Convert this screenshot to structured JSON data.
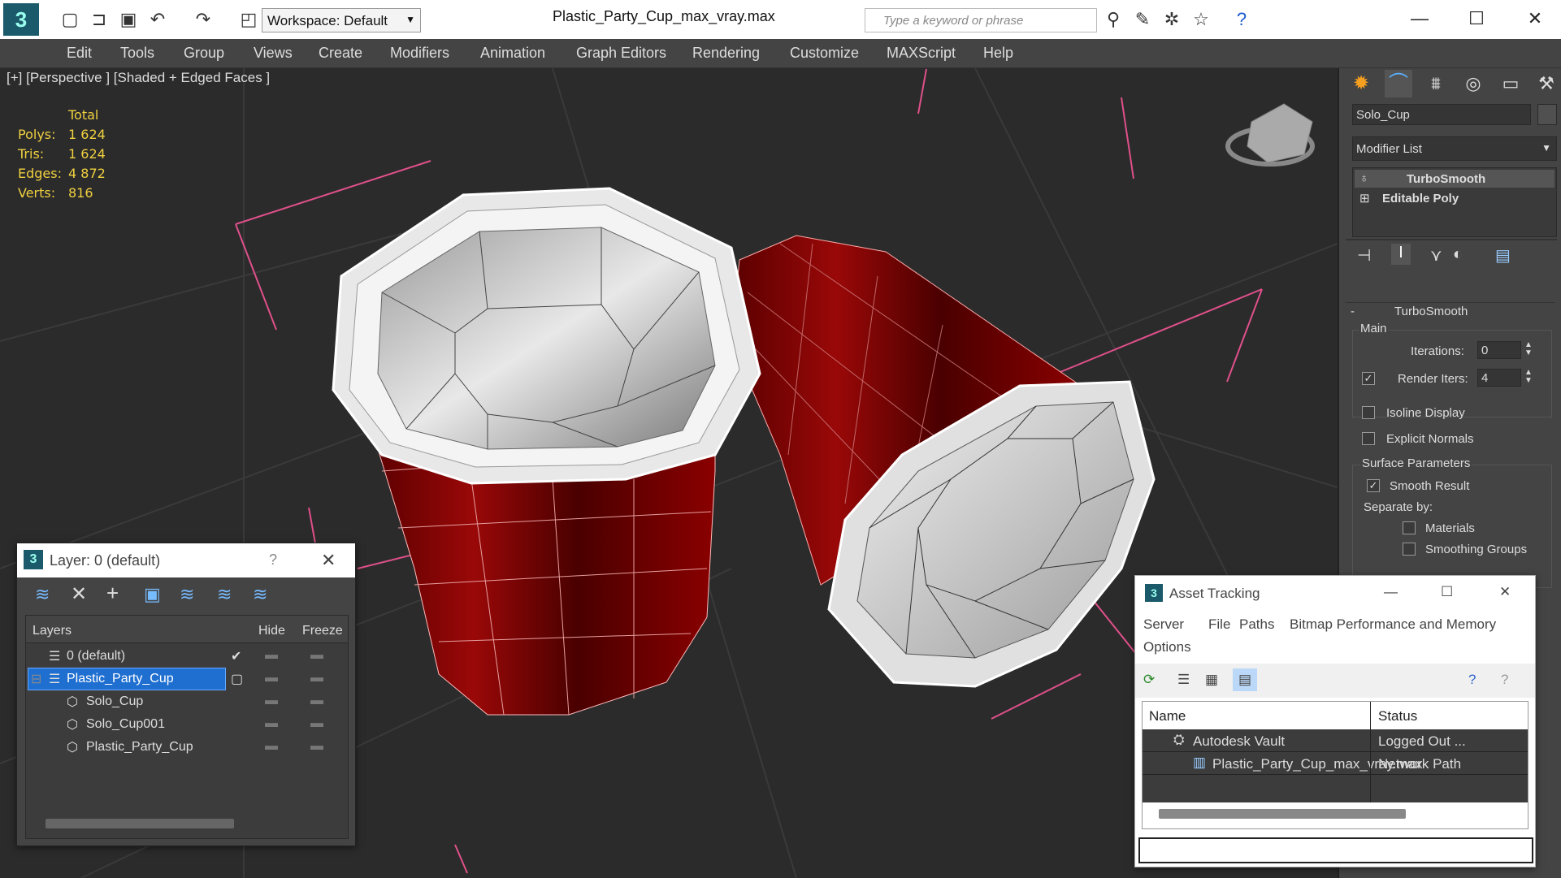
{
  "titlebar": {
    "workspace": "Workspace: Default",
    "file_title": "Plastic_Party_Cup_max_vray.max",
    "search_placeholder": "Type a keyword or phrase"
  },
  "menu": [
    "Edit",
    "Tools",
    "Group",
    "Views",
    "Create",
    "Modifiers",
    "Animation",
    "Graph Editors",
    "Rendering",
    "Customize",
    "MAXScript",
    "Help"
  ],
  "viewport": {
    "label": "[+] [Perspective ] [Shaded + Edged Faces ]",
    "stats_header": "Total",
    "stats": [
      {
        "label": "Polys:",
        "value": "1 624"
      },
      {
        "label": "Tris:",
        "value": "1 624"
      },
      {
        "label": "Edges:",
        "value": "4 872"
      },
      {
        "label": "Verts:",
        "value": "816"
      }
    ]
  },
  "command_panel": {
    "object_name": "Solo_Cup",
    "modifier_list": "Modifier List",
    "stack": [
      "TurboSmooth",
      "Editable Poly"
    ],
    "rollout_title": "TurboSmooth",
    "main_label": "Main",
    "iterations_label": "Iterations:",
    "iterations_value": "0",
    "render_iters_label": "Render Iters:",
    "render_iters_value": "4",
    "isoline": "Isoline Display",
    "explicit_normals": "Explicit Normals",
    "surface_params": "Surface Parameters",
    "smooth_result": "Smooth Result",
    "separate_by": "Separate by:",
    "materials": "Materials",
    "smoothing_groups": "Smoothing Groups"
  },
  "layer_window": {
    "title": "Layer: 0 (default)",
    "help": "?",
    "col_layers": "Layers",
    "col_hide": "Hide",
    "col_freeze": "Freeze",
    "rows": [
      {
        "name": "0 (default)",
        "indent": 0
      },
      {
        "name": "Plastic_Party_Cup",
        "indent": 0,
        "selected": true
      },
      {
        "name": "Solo_Cup",
        "indent": 1
      },
      {
        "name": "Solo_Cup001",
        "indent": 1
      },
      {
        "name": "Plastic_Party_Cup",
        "indent": 1
      }
    ]
  },
  "asset_window": {
    "title": "Asset Tracking",
    "menu": [
      "Server",
      "File",
      "Paths",
      "Bitmap Performance and Memory",
      "Options"
    ],
    "col_name": "Name",
    "col_status": "Status",
    "rows": [
      {
        "name": "Autodesk Vault",
        "status": "Logged Out ..."
      },
      {
        "name": "Plastic_Party_Cup_max_vray.max",
        "status": "Network Path"
      }
    ]
  },
  "colors": {
    "viewport_bg": "#2b2b2b",
    "cup_red": "#8a0000",
    "cup_white": "#d8d8d8",
    "layer_selected": "#1f6fd0",
    "stats_yellow": "#f0d040"
  }
}
